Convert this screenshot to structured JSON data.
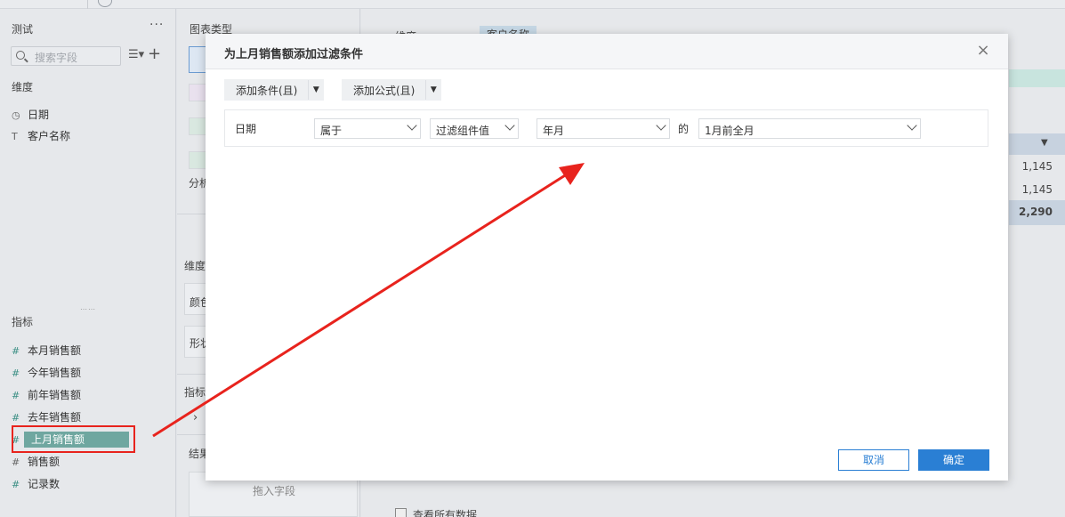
{
  "left_panel": {
    "title": "测试",
    "more": "···",
    "search_placeholder": "搜索字段",
    "dimensions_label": "维度",
    "dimensions": [
      {
        "icon": "clock-icon",
        "glyph": "◷",
        "label": "日期"
      },
      {
        "icon": "text-icon",
        "glyph": "T",
        "label": "客户名称"
      }
    ],
    "measures_label": "指标",
    "measures": [
      {
        "icon": "calc-measure-icon",
        "glyph": "#",
        "label": "本月销售额"
      },
      {
        "icon": "calc-measure-icon",
        "glyph": "#",
        "label": "今年销售额"
      },
      {
        "icon": "calc-measure-icon",
        "glyph": "#",
        "label": "前年销售额"
      },
      {
        "icon": "calc-measure-icon",
        "glyph": "#",
        "label": "去年销售额"
      },
      {
        "icon": "calc-measure-icon",
        "glyph": "#",
        "label": "上月销售额",
        "selected": true
      },
      {
        "icon": "measure-icon",
        "glyph": "#",
        "label": "销售额"
      },
      {
        "icon": "calc-measure-icon",
        "glyph": "#",
        "label": "记录数"
      }
    ]
  },
  "mid_panel": {
    "chart_type_label": "图表类型",
    "dimension_label": "维度",
    "color_label": "颜色",
    "shape_label": "形状",
    "measure_label": "指标",
    "result_label": "结果",
    "drop_placeholder": "拖入字段",
    "partial_label": "分析"
  },
  "right_panel": {
    "dim_label": "维度",
    "dim_tag": "客户名称",
    "values": [
      "1,145",
      "1,145",
      "2,290"
    ],
    "show_all_label": "查看所有数据"
  },
  "modal": {
    "title": "为上月销售额添加过滤条件",
    "add_condition": "添加条件(且)",
    "add_formula": "添加公式(且)",
    "condition": {
      "field": "日期",
      "operator": "属于",
      "value_type": "过滤组件值",
      "granularity": "年月",
      "connector": "的",
      "target": "1月前全月"
    },
    "cancel": "取消",
    "confirm": "确定"
  },
  "colors": {
    "accent": "#2a7fd4",
    "selected_field": "#6fa7a0",
    "annotation": "#e8231d"
  }
}
